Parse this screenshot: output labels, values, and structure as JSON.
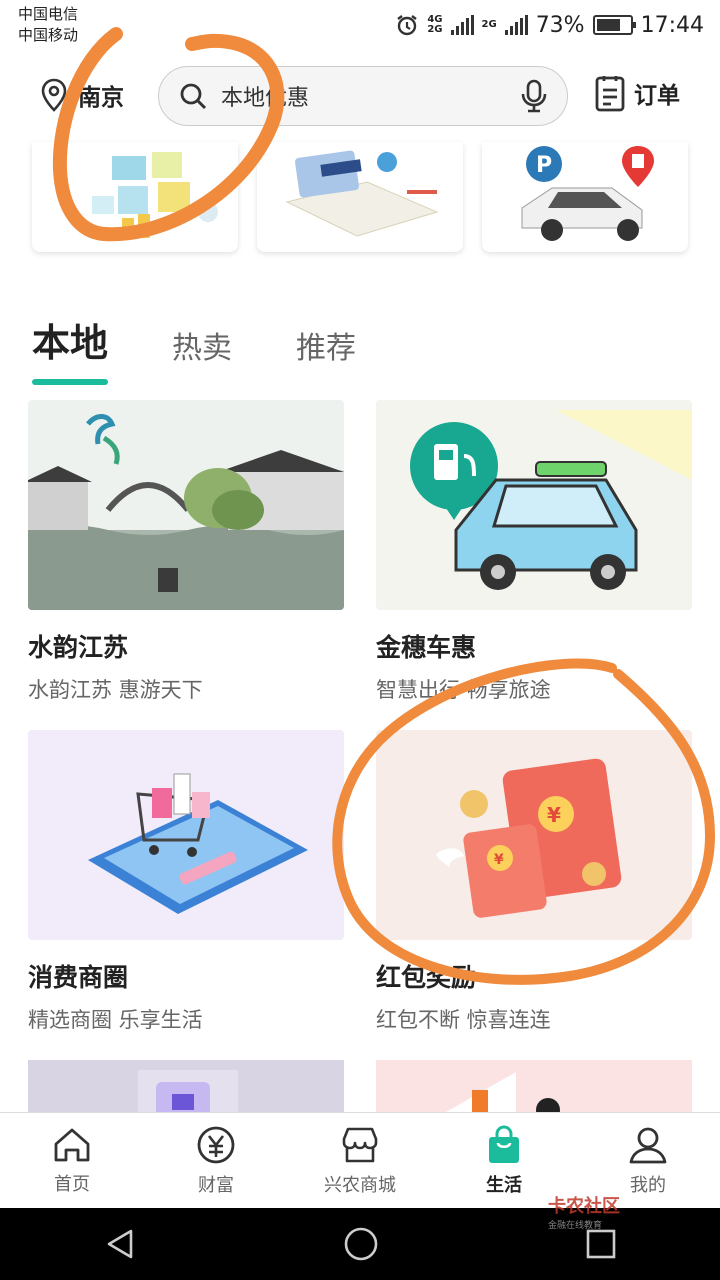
{
  "status": {
    "carrier1": "中国电信",
    "carrier2": "中国移动",
    "net1_top": "4G",
    "net1_bottom": "2G",
    "net2": "2G",
    "battery": "73%",
    "battery_level": 0.73,
    "time": "17:44"
  },
  "topbar": {
    "city": "南京",
    "search_placeholder": "本地优惠",
    "orders_label": "订单"
  },
  "tabs": [
    {
      "label": "本地"
    },
    {
      "label": "热卖"
    },
    {
      "label": "推荐"
    }
  ],
  "items": [
    {
      "title": "水韵江苏",
      "subtitle": "水韵江苏 惠游天下"
    },
    {
      "title": "金穗车惠",
      "subtitle": "智慧出行 畅享旅途"
    },
    {
      "title": "消费商圈",
      "subtitle": "精选商圈 乐享生活"
    },
    {
      "title": "红包奖励",
      "subtitle": "红包不断 惊喜连连"
    }
  ],
  "nav": [
    {
      "label": "首页"
    },
    {
      "label": "财富"
    },
    {
      "label": "兴农商城"
    },
    {
      "label": "生活"
    },
    {
      "label": "我的"
    }
  ],
  "watermark": {
    "brand": "卡农社区",
    "tagline": "金融在线教育"
  },
  "colors": {
    "accent": "#1abc9c",
    "annotation": "#f08a3c"
  }
}
